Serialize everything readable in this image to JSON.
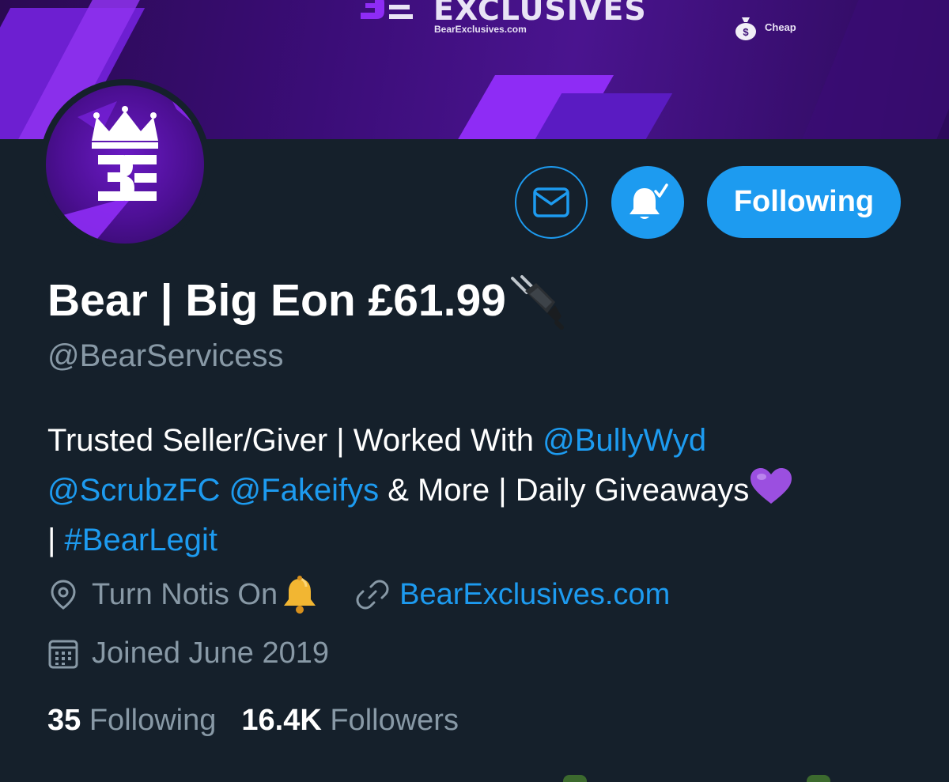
{
  "banner": {
    "title": "EXCLUSIVES",
    "url": "BearExclusives.com",
    "cheap_label": "Cheap",
    "bag_icon": "money-bag-icon"
  },
  "avatar": {
    "letters": "BE",
    "icon": "crown-icon"
  },
  "actions": {
    "message_icon": "envelope-icon",
    "notify_icon": "bell-check-icon",
    "following_label": "Following"
  },
  "profile": {
    "display_name": "Bear | Big Eon £61.99",
    "display_name_emoji": "plug-icon",
    "handle": "@BearServicess",
    "bio": {
      "text1": "Trusted Seller/Giver | Worked With ",
      "mention1": "@BullyWyd",
      "mention2": "@ScrubzFC",
      "space": " ",
      "mention3": "@Fakeifys",
      "text2": " & More | Daily Giveaways",
      "heart": "purple-heart-icon",
      "text3": "| ",
      "hashtag": "#BearLegit"
    },
    "location": "Turn Notis On",
    "location_emoji": "bell-icon",
    "website": "BearExclusives.com",
    "joined": "Joined June 2019"
  },
  "stats": {
    "following_count": "35",
    "following_label": "Following",
    "followers_count": "16.4K",
    "followers_label": "Followers"
  },
  "colors": {
    "background": "#15202b",
    "accent": "#1d9bf0",
    "muted": "#8899a6",
    "banner_purple": "#8a2be2"
  }
}
